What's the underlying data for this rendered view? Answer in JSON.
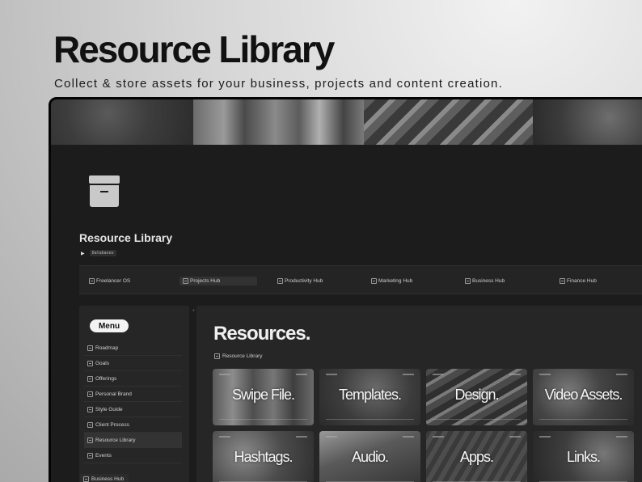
{
  "hero": {
    "title": "Resource Library",
    "subtitle": "Collect & store assets for your business, projects and content creation."
  },
  "page": {
    "icon": "archive-box-icon",
    "title": "Resource Library",
    "toggle_label": "Databases"
  },
  "hubs": [
    {
      "label": "Freelancer OS",
      "active": false
    },
    {
      "label": "Projects Hub",
      "active": true
    },
    {
      "label": "Productivity Hub",
      "active": false
    },
    {
      "label": "Marketing Hub",
      "active": false
    },
    {
      "label": "Business Hub",
      "active": false
    },
    {
      "label": "Finance Hub",
      "active": false
    }
  ],
  "sidebar": {
    "menu_label": "Menu",
    "items": [
      {
        "label": "Roadmap",
        "active": false
      },
      {
        "label": "Goals",
        "active": false
      },
      {
        "label": "Offerings",
        "active": false
      },
      {
        "label": "Personal Brand",
        "active": false
      },
      {
        "label": "Style Guide",
        "active": false
      },
      {
        "label": "Client Process",
        "active": false
      },
      {
        "label": "Resource Library",
        "active": true
      },
      {
        "label": "Events",
        "active": false
      }
    ],
    "bottom_link": "Business Hub"
  },
  "main": {
    "title": "Resources.",
    "breadcrumb": "Resource Library",
    "cards": [
      {
        "label": "Swipe File."
      },
      {
        "label": "Templates."
      },
      {
        "label": "Design."
      },
      {
        "label": "Video Assets."
      },
      {
        "label": "Hashtags."
      },
      {
        "label": "Audio."
      },
      {
        "label": "Apps."
      },
      {
        "label": "Links."
      }
    ]
  },
  "colors": {
    "device_bg": "#1c1c1c",
    "panel_bg": "#262626",
    "text_light": "#e6e6e6"
  }
}
